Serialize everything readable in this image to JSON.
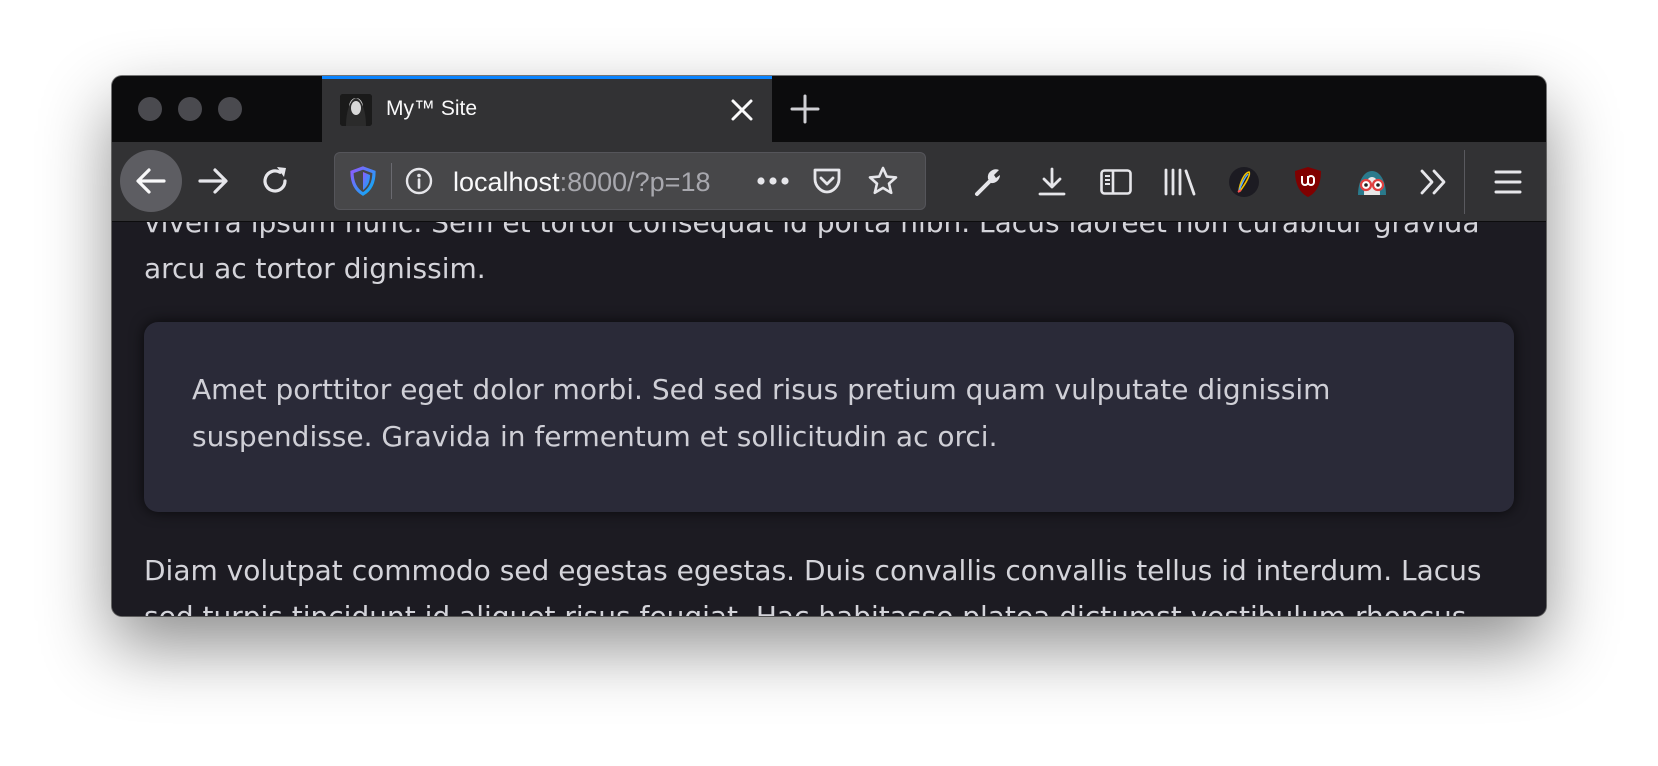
{
  "tab": {
    "title": "My™ Site",
    "favicon": "portrait-favicon"
  },
  "urlbar": {
    "host": "localhost",
    "rest": ":8000/?p=18",
    "icons": [
      "tracking-protection-shield-icon",
      "site-info-icon",
      "page-actions-icon",
      "pocket-icon",
      "bookmark-star-icon"
    ]
  },
  "toolbar": {
    "icons": [
      "developer-wrench-icon",
      "downloads-icon",
      "sidebar-icon",
      "library-icon",
      "pen-extension-icon",
      "ublock-origin-icon",
      "privacy-badger-icon",
      "overflow-chevron-icon",
      "hamburger-menu-icon"
    ]
  },
  "content": {
    "para1": "viverra ipsum nunc. Sem et tortor consequat id porta nibh. Lacus laoreet non curabitur gravida arcu ac tortor dignissim.",
    "callout": "Amet porttitor eget dolor morbi. Sed sed risus pretium quam vulputate dignissim suspendisse. Gravida in fermentum et sollicitudin ac orci.",
    "para3": "Diam volutpat commodo sed egestas egestas. Duis convallis convallis tellus id interdum. Lacus sed turpis tincidunt id aliquet risus feugiat. Hac habitasse platea dictumst vestibulum rhoncus."
  },
  "colors": {
    "accent": "#0a84ff",
    "ublock": "#800000"
  }
}
